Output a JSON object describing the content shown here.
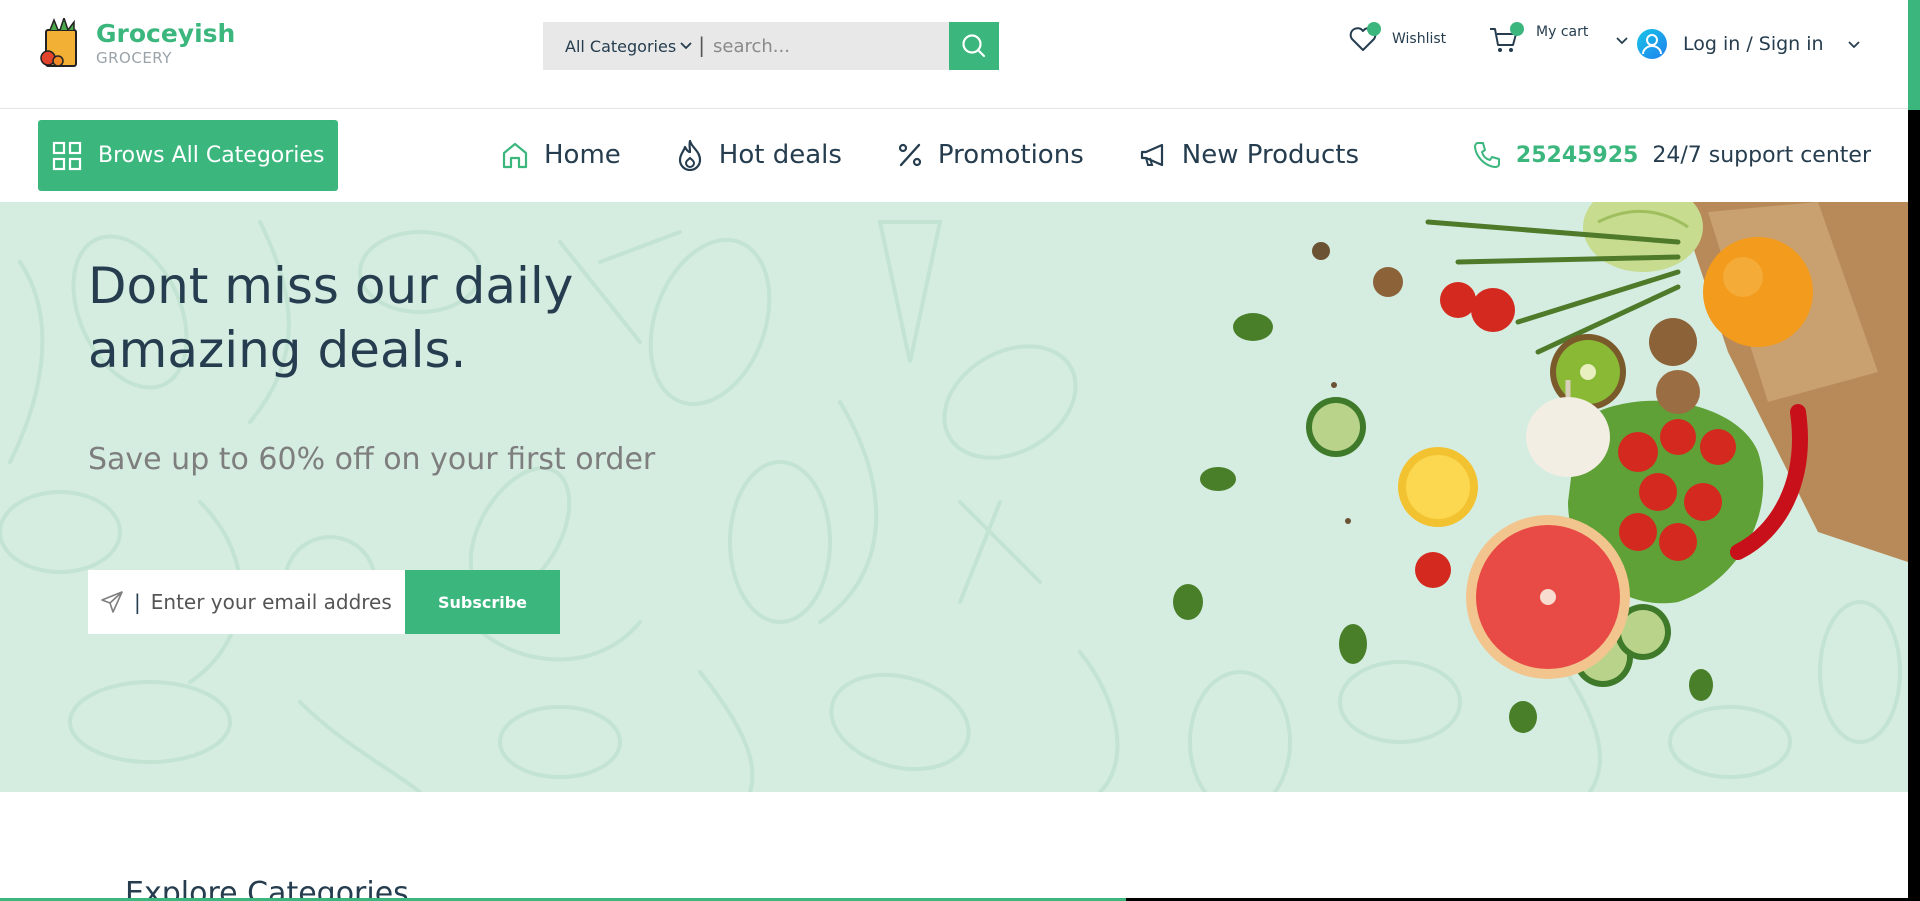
{
  "brand": {
    "name": "Groceyish",
    "tagline": "GROCERY"
  },
  "search": {
    "category": "All Categories",
    "placeholder": "search..."
  },
  "actions": {
    "wishlist_label": "Wishlist",
    "cart_label": "My cart",
    "account_label": "Log in / Sign in"
  },
  "nav": {
    "browse_label": "Brows All Categories",
    "items": [
      {
        "label": "Home",
        "icon": "home-icon"
      },
      {
        "label": "Hot deals",
        "icon": "flame-icon"
      },
      {
        "label": "Promotions",
        "icon": "percent-icon"
      },
      {
        "label": "New Products",
        "icon": "megaphone-icon"
      }
    ],
    "support_number": "25245925",
    "support_label": "24/7 support center"
  },
  "hero": {
    "title_line1": "Dont miss our daily",
    "title_line2": "amazing deals.",
    "subtitle": "Save up to 60% off on your first order",
    "email_placeholder": "Enter your email address",
    "subscribe_label": "Subscribe"
  },
  "section": {
    "title": "Explore Categories"
  },
  "page_scroll_progress": 0.59,
  "colors": {
    "accent": "#3bb77e",
    "hero_bg": "#d5ede1",
    "text": "#253d4e",
    "muted": "#7e7e7e"
  }
}
